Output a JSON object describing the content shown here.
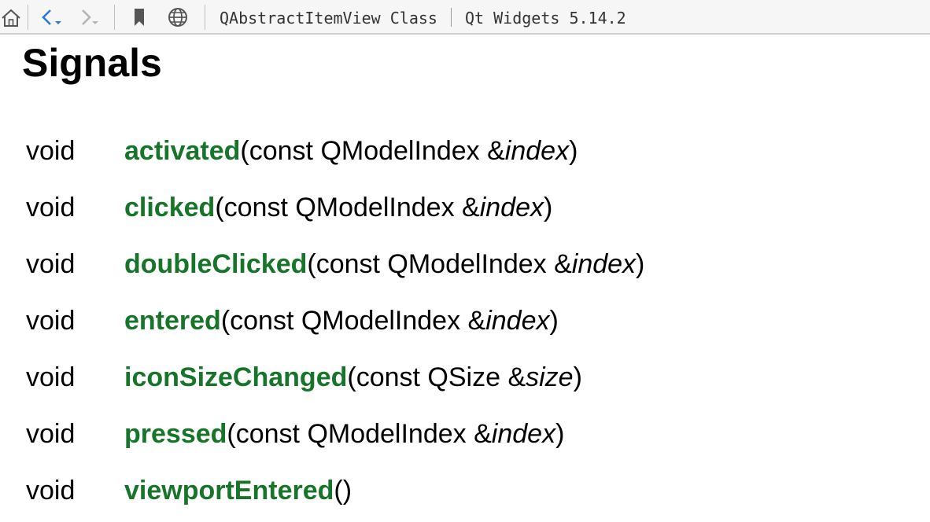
{
  "toolbar": {
    "icons": {
      "home": "home-icon",
      "back": "back-arrow-icon",
      "forward": "forward-arrow-icon",
      "bookmark": "bookmark-icon",
      "browser": "globe-icon"
    },
    "breadcrumbs": [
      "QAbstractItemView Class",
      "Qt Widgets 5.14.2"
    ]
  },
  "page": {
    "heading": "Signals"
  },
  "signals": [
    {
      "type": "void",
      "name": "activated",
      "open": "(const QModelIndex &",
      "param": "index",
      "close": ")"
    },
    {
      "type": "void",
      "name": "clicked",
      "open": "(const QModelIndex &",
      "param": "index",
      "close": ")"
    },
    {
      "type": "void",
      "name": "doubleClicked",
      "open": "(const QModelIndex &",
      "param": "index",
      "close": ")"
    },
    {
      "type": "void",
      "name": "entered",
      "open": "(const QModelIndex &",
      "param": "index",
      "close": ")"
    },
    {
      "type": "void",
      "name": "iconSizeChanged",
      "open": "(const QSize &",
      "param": "size",
      "close": ")"
    },
    {
      "type": "void",
      "name": "pressed",
      "open": "(const QModelIndex &",
      "param": "index",
      "close": ")"
    },
    {
      "type": "void",
      "name": "viewportEntered",
      "open": "()",
      "param": "",
      "close": ""
    }
  ],
  "colors": {
    "link": "#17752a",
    "toolbar_bg": "#f6f6f6",
    "back_arrow": "#2a7bd6"
  }
}
